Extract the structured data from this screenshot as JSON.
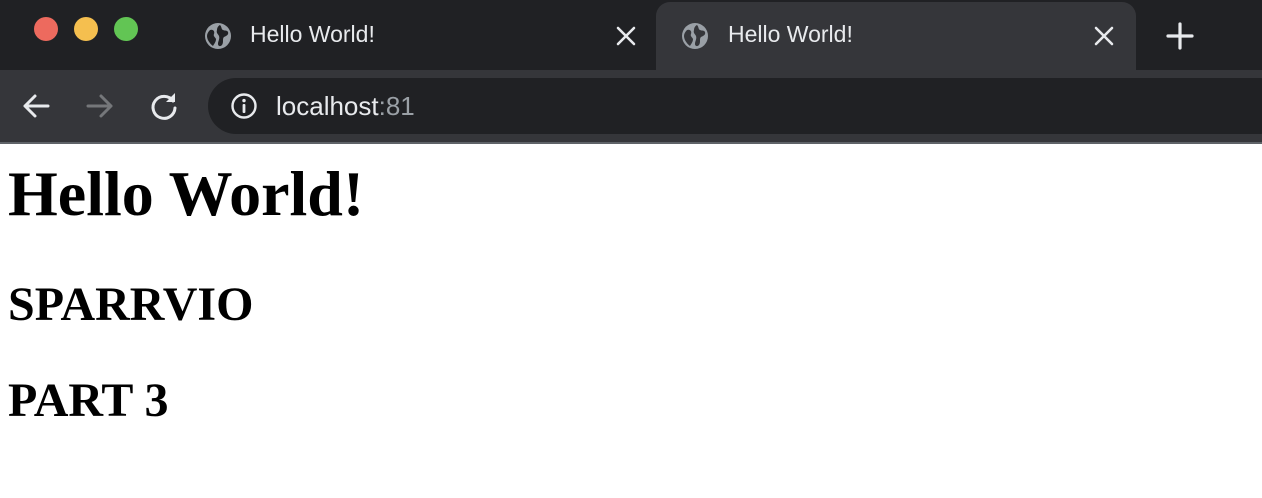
{
  "tabs": [
    {
      "title": "Hello World!",
      "favicon": "globe-icon",
      "active": false
    },
    {
      "title": "Hello World!",
      "favicon": "globe-icon",
      "active": true
    }
  ],
  "toolbar": {
    "address": {
      "host": "localhost",
      "port": ":81",
      "security_icon": "info-icon"
    }
  },
  "page": {
    "heading": "Hello World!",
    "subheading_1": "SPARRVIO",
    "subheading_2": "PART 3"
  },
  "colors": {
    "tabstrip_bg": "#202124",
    "toolbar_bg": "#35363a",
    "text_light": "#e8eaed",
    "text_dim": "#9aa0a6"
  }
}
